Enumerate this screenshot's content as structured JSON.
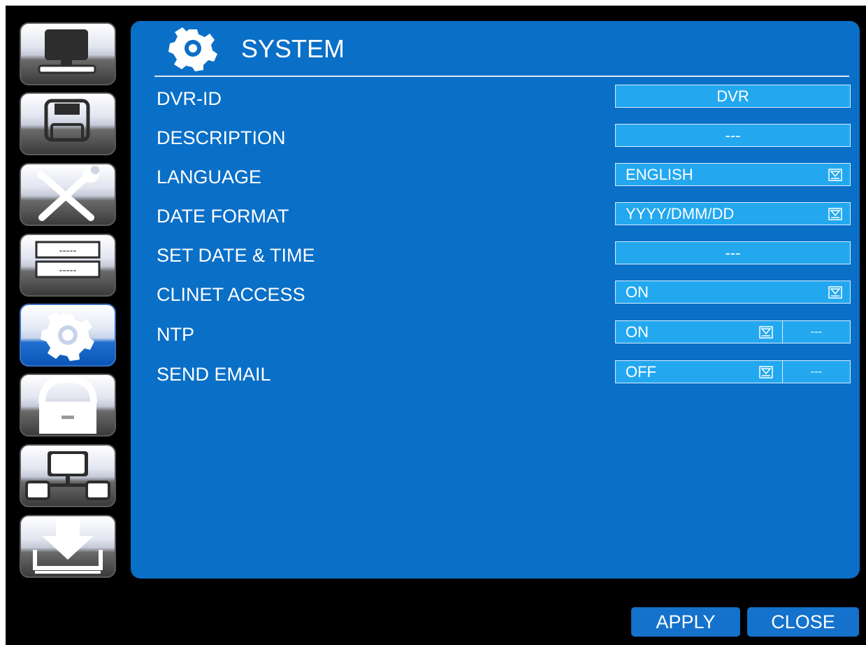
{
  "sidebar": {
    "items": [
      {
        "icon": "monitor-icon",
        "active": false
      },
      {
        "icon": "floppy-disk-icon",
        "active": false
      },
      {
        "icon": "tools-icon",
        "active": false
      },
      {
        "icon": "device-list-icon",
        "active": false,
        "lines": [
          "-----",
          "-----"
        ]
      },
      {
        "icon": "gear-icon",
        "active": true
      },
      {
        "icon": "lock-icon",
        "active": false
      },
      {
        "icon": "network-icon",
        "active": false
      },
      {
        "icon": "download-icon",
        "active": false
      }
    ]
  },
  "panel": {
    "title": "SYSTEM",
    "header_icon": "gear-icon"
  },
  "rows": [
    {
      "label": "DVR-ID",
      "value": "DVR"
    },
    {
      "label": "DESCRIPTION",
      "value": "---"
    },
    {
      "label": "LANGUAGE",
      "value": "ENGLISH"
    },
    {
      "label": "DATE FORMAT",
      "value": "YYYY/DMM/DD"
    },
    {
      "label": "SET DATE & TIME",
      "value": "---"
    },
    {
      "label": "CLINET ACCESS",
      "value": "ON"
    },
    {
      "label": "NTP",
      "value": "ON",
      "extra": "---"
    },
    {
      "label": "SEND EMAIL",
      "value": "OFF",
      "extra": "---"
    }
  ],
  "footer": {
    "apply": "APPLY",
    "close": "CLOSE"
  },
  "colors": {
    "background": "#000000",
    "panel": "#0a6fc7",
    "field": "#23a8f0",
    "button": "#1472cc"
  }
}
